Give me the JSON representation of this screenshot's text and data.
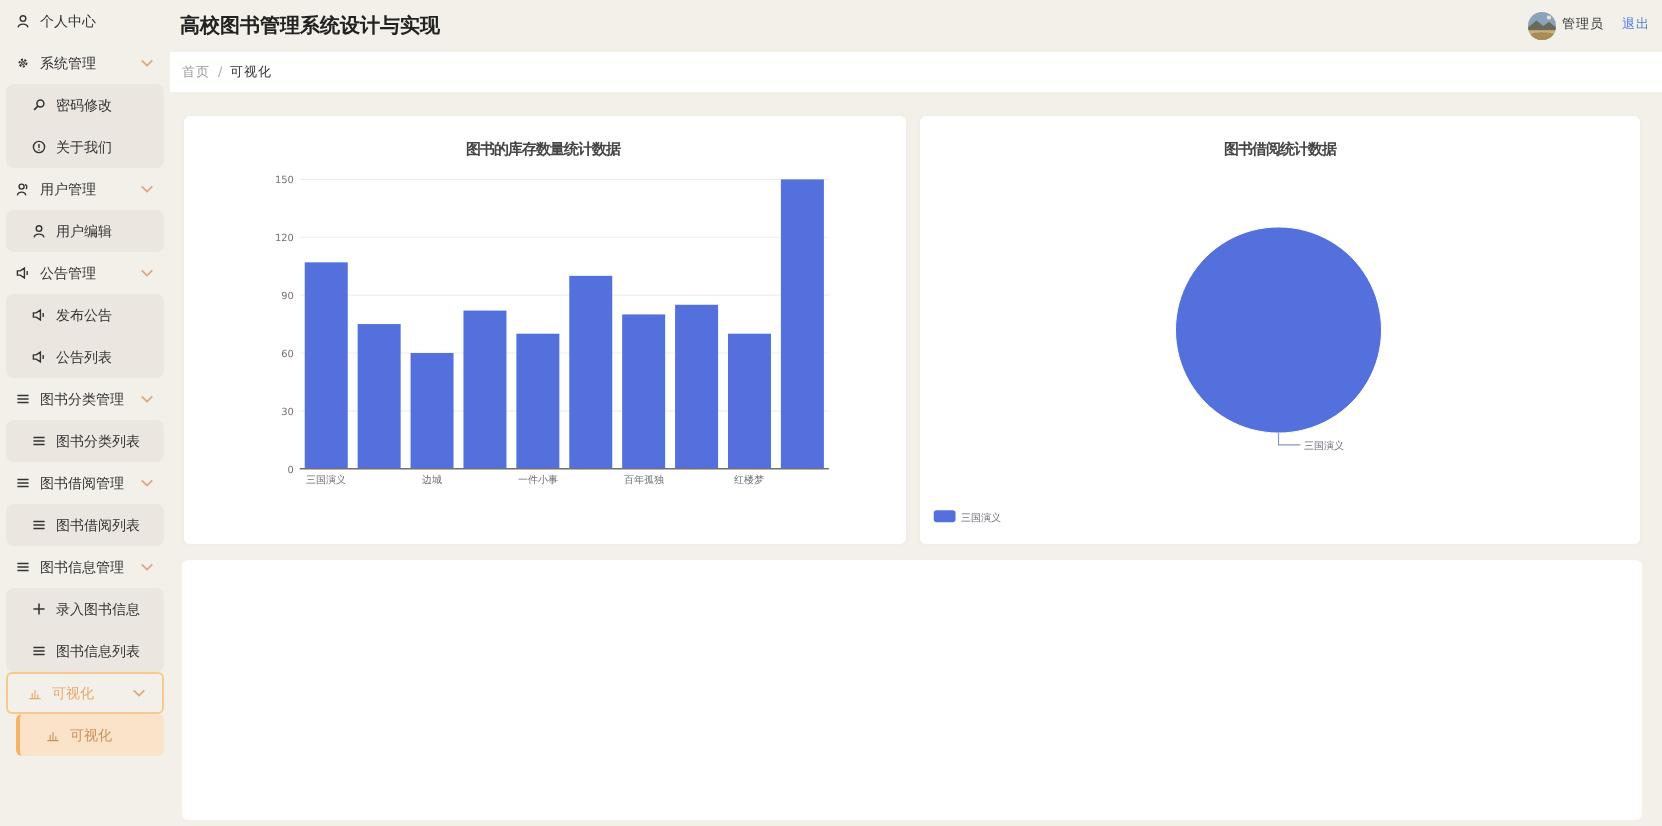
{
  "header": {
    "title": "高校图书管理系统设计与实现",
    "user": "管理员",
    "logout": "退出"
  },
  "breadcrumb": {
    "items": [
      "首页",
      "可视化"
    ],
    "separator": "/"
  },
  "sidebar": {
    "items": [
      {
        "label": "个人中心",
        "selected": false
      },
      {
        "label": "系统管理",
        "selected": false,
        "expanded": true,
        "children": [
          {
            "label": "密码修改",
            "selected": false
          },
          {
            "label": "关于我们",
            "selected": false
          }
        ]
      },
      {
        "label": "用户管理",
        "selected": false,
        "expanded": true,
        "children": [
          {
            "label": "用户编辑",
            "selected": false
          }
        ]
      },
      {
        "label": "公告管理",
        "selected": false,
        "expanded": true,
        "children": [
          {
            "label": "发布公告",
            "selected": false
          },
          {
            "label": "公告列表",
            "selected": false
          }
        ]
      },
      {
        "label": "图书分类管理",
        "selected": false,
        "expanded": true,
        "children": [
          {
            "label": "图书分类列表",
            "selected": false
          }
        ]
      },
      {
        "label": "图书借阅管理",
        "selected": false,
        "expanded": true,
        "children": [
          {
            "label": "图书借阅列表",
            "selected": false
          }
        ]
      },
      {
        "label": "图书信息管理",
        "selected": false,
        "expanded": true,
        "children": [
          {
            "label": "录入图书信息",
            "selected": false
          },
          {
            "label": "图书信息列表",
            "selected": false
          }
        ]
      },
      {
        "label": "可视化",
        "selected": true,
        "expanded": true,
        "children": [
          {
            "label": "可视化",
            "selected": true
          }
        ]
      }
    ]
  },
  "charts": [
    {
      "chart_data": {
        "type": "bar",
        "title": "图书的库存数量统计数据",
        "categories": [
          "三国演义",
          null,
          "边城",
          null,
          "一件小事",
          null,
          "百年孤独",
          null,
          "红楼梦",
          null
        ],
        "values": [
          107,
          75,
          60,
          82,
          70,
          100,
          80,
          85,
          70,
          150
        ],
        "ylim": [
          0,
          150
        ],
        "yticks": [
          0,
          30,
          60,
          90,
          120,
          150
        ],
        "grid": true
      }
    },
    {
      "chart_data": {
        "type": "pie",
        "title": "图书借阅统计数据",
        "categories": [
          "三国演义"
        ],
        "values": [
          1
        ]
      },
      "legend_items": [
        {
          "label": "三国演义"
        }
      ]
    }
  ]
}
